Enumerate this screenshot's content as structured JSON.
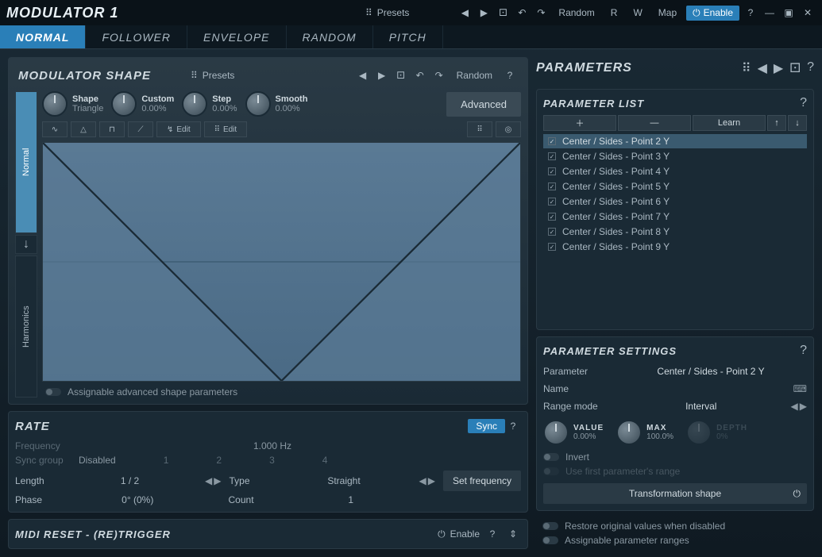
{
  "title": "MODULATOR 1",
  "titlebar": {
    "presets": "Presets",
    "random": "Random",
    "r": "R",
    "w": "W",
    "map": "Map",
    "enable": "Enable"
  },
  "tabs": [
    "NORMAL",
    "FOLLOWER",
    "ENVELOPE",
    "RANDOM",
    "PITCH"
  ],
  "shape": {
    "title": "MODULATOR SHAPE",
    "presets": "Presets",
    "random": "Random",
    "knobs": [
      {
        "name": "Shape",
        "val": "Triangle"
      },
      {
        "name": "Custom",
        "val": "0.00%"
      },
      {
        "name": "Step",
        "val": "0.00%"
      },
      {
        "name": "Smooth",
        "val": "0.00%"
      }
    ],
    "advanced": "Advanced",
    "edit": "Edit",
    "vtabs": {
      "normal": "Normal",
      "harmonics": "Harmonics"
    },
    "assignable": "Assignable advanced shape parameters"
  },
  "rate": {
    "title": "RATE",
    "sync": "Sync",
    "frequency_label": "Frequency",
    "frequency_val": "1.000 Hz",
    "syncgroup_label": "Sync group",
    "syncgroup_val": "Disabled",
    "sync_nums": [
      "1",
      "2",
      "3",
      "4"
    ],
    "length_label": "Length",
    "length_val": "1 / 2",
    "type_label": "Type",
    "type_val": "Straight",
    "phase_label": "Phase",
    "phase_val": "0° (0%)",
    "count_label": "Count",
    "count_val": "1",
    "setfreq": "Set frequency"
  },
  "midi": {
    "title": "MIDI RESET - (RE)TRIGGER",
    "enable": "Enable"
  },
  "parameters": {
    "title": "PARAMETERS",
    "list_title": "PARAMETER LIST",
    "learn": "Learn",
    "items": [
      "Center / Sides - Point 2 Y",
      "Center / Sides - Point 3 Y",
      "Center / Sides - Point 4 Y",
      "Center / Sides - Point 5 Y",
      "Center / Sides - Point 6 Y",
      "Center / Sides - Point 7 Y",
      "Center / Sides - Point 8 Y",
      "Center / Sides - Point 9 Y"
    ],
    "settings": {
      "title": "PARAMETER SETTINGS",
      "parameter_label": "Parameter",
      "parameter_val": "Center / Sides - Point 2 Y",
      "name_label": "Name",
      "range_label": "Range mode",
      "range_val": "Interval",
      "knobs": [
        {
          "name": "VALUE",
          "val": "0.00%"
        },
        {
          "name": "MAX",
          "val": "100.0%"
        },
        {
          "name": "DEPTH",
          "val": "0%"
        }
      ],
      "invert": "Invert",
      "usefirst": "Use first parameter's range",
      "transform": "Transformation shape"
    },
    "restore": "Restore original values when disabled",
    "assignable_ranges": "Assignable parameter ranges"
  }
}
